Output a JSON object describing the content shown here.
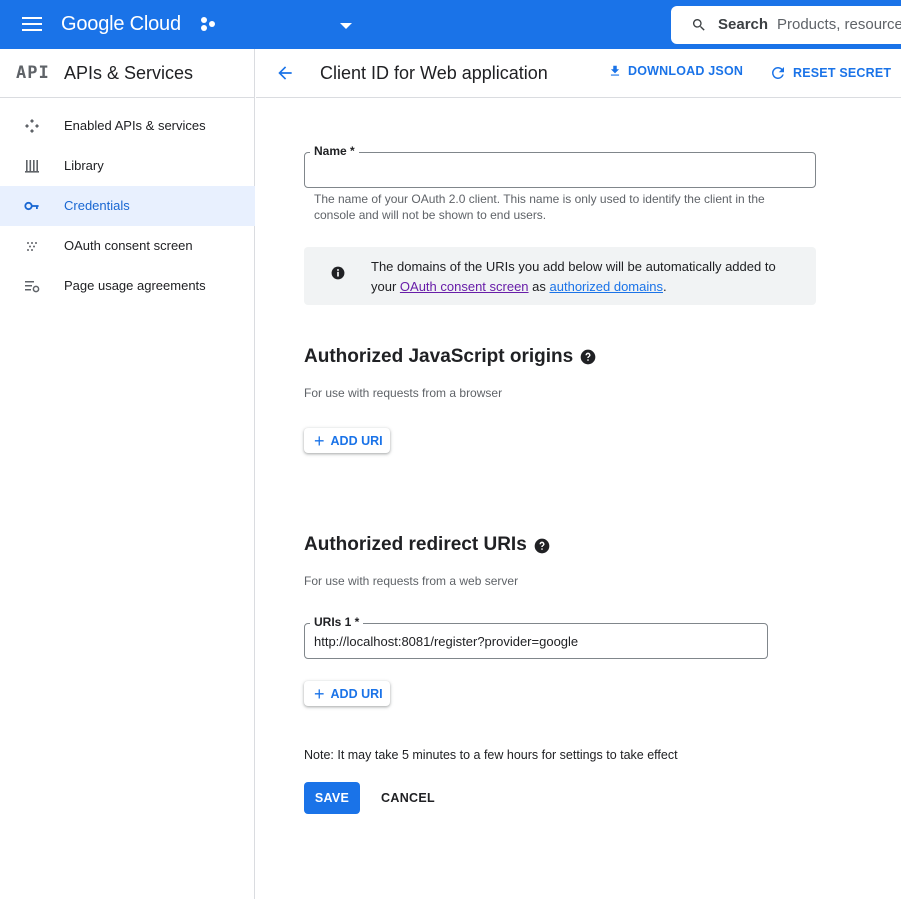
{
  "topbar": {
    "brand": "Google Cloud",
    "search_label": "Search",
    "search_placeholder": "Products, resources"
  },
  "sidebar": {
    "logo": "API",
    "title": "APIs & Services",
    "items": [
      {
        "label": "Enabled APIs & services",
        "icon": "api-hub-icon",
        "active": false
      },
      {
        "label": "Library",
        "icon": "library-icon",
        "active": false
      },
      {
        "label": "Credentials",
        "icon": "key-icon",
        "active": true
      },
      {
        "label": "OAuth consent screen",
        "icon": "dots-grid-icon",
        "active": false
      },
      {
        "label": "Page usage agreements",
        "icon": "settings-list-icon",
        "active": false
      }
    ]
  },
  "header": {
    "title": "Client ID for Web application",
    "download_label": "DOWNLOAD JSON",
    "reset_label": "RESET SECRET"
  },
  "form": {
    "name_label": "Name *",
    "name_value": "",
    "name_help": "The name of your OAuth 2.0 client. This name is only used to identify the client in the console and will not be shown to end users.",
    "info": {
      "text_before": "The domains of the URIs you add below will be automatically added to your ",
      "link1": "OAuth consent screen",
      "text_mid": " as ",
      "link2": "authorized domains",
      "text_after": "."
    },
    "js_origins": {
      "title": "Authorized JavaScript origins",
      "subtitle": "For use with requests from a browser",
      "add_label": "ADD URI"
    },
    "redirect": {
      "title": "Authorized redirect URIs",
      "subtitle": "For use with requests from a web server",
      "uri_label": "URIs 1 *",
      "uri_value": "http://localhost:8081/register?provider=google",
      "add_label": "ADD URI"
    },
    "note": "Note: It may take 5 minutes to a few hours for settings to take effect",
    "save_label": "SAVE",
    "cancel_label": "CANCEL"
  },
  "colors": {
    "brand_blue": "#1a73e8",
    "active_bg": "#e8f0fe",
    "link_purple": "#681da8"
  }
}
